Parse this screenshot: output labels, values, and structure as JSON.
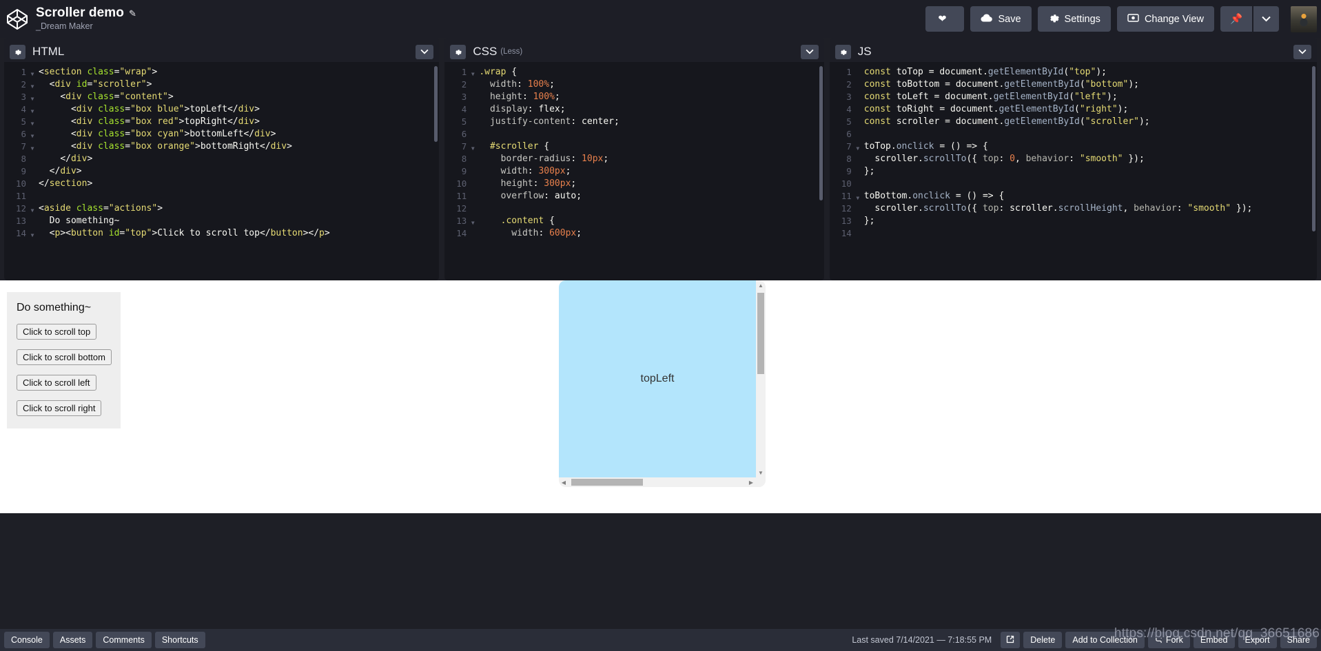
{
  "header": {
    "logo_icon": "codepen-logo-icon",
    "pen_title": "Scroller demo",
    "edit_icon": "pencil-icon",
    "author": "_Dream Maker",
    "buttons": {
      "love_label": "",
      "love_icon": "heart-icon",
      "save_label": "Save",
      "save_icon": "cloud-icon",
      "settings_label": "Settings",
      "settings_icon": "gear-icon",
      "change_view_label": "Change View",
      "change_view_icon": "eye-icon",
      "pin_icon": "pin-icon",
      "caret_icon": "chevron-down-icon",
      "avatar_icon": "user-avatar"
    }
  },
  "editors": {
    "html": {
      "title": "HTML",
      "sub": "",
      "gear_icon": "gear-icon",
      "caret_icon": "chevron-down-icon",
      "lines": [
        {
          "n": "1",
          "fold": true,
          "html": "<span class=\"t-punc\">&lt;</span><span class=\"t-tag\">section</span> <span class=\"t-attr\">class</span><span class=\"t-punc\">=</span><span class=\"t-str\">\"wrap\"</span><span class=\"t-punc\">&gt;</span>"
        },
        {
          "n": "2",
          "fold": true,
          "html": "  <span class=\"t-punc\">&lt;</span><span class=\"t-tag\">div</span> <span class=\"t-attr\">id</span><span class=\"t-punc\">=</span><span class=\"t-str\">\"scroller\"</span><span class=\"t-punc\">&gt;</span>"
        },
        {
          "n": "3",
          "fold": true,
          "html": "    <span class=\"t-punc\">&lt;</span><span class=\"t-tag\">div</span> <span class=\"t-attr\">class</span><span class=\"t-punc\">=</span><span class=\"t-str\">\"content\"</span><span class=\"t-punc\">&gt;</span>"
        },
        {
          "n": "4",
          "fold": true,
          "html": "      <span class=\"t-punc\">&lt;</span><span class=\"t-tag\">div</span> <span class=\"t-attr\">class</span><span class=\"t-punc\">=</span><span class=\"t-str\">\"box blue\"</span><span class=\"t-punc\">&gt;</span><span class=\"t-txt\">topLeft</span><span class=\"t-punc\">&lt;/</span><span class=\"t-tag\">div</span><span class=\"t-punc\">&gt;</span>"
        },
        {
          "n": "5",
          "fold": true,
          "html": "      <span class=\"t-punc\">&lt;</span><span class=\"t-tag\">div</span> <span class=\"t-attr\">class</span><span class=\"t-punc\">=</span><span class=\"t-str\">\"box red\"</span><span class=\"t-punc\">&gt;</span><span class=\"t-txt\">topRight</span><span class=\"t-punc\">&lt;/</span><span class=\"t-tag\">div</span><span class=\"t-punc\">&gt;</span>"
        },
        {
          "n": "6",
          "fold": true,
          "html": "      <span class=\"t-punc\">&lt;</span><span class=\"t-tag\">div</span> <span class=\"t-attr\">class</span><span class=\"t-punc\">=</span><span class=\"t-str\">\"box cyan\"</span><span class=\"t-punc\">&gt;</span><span class=\"t-txt\">bottomLeft</span><span class=\"t-punc\">&lt;/</span><span class=\"t-tag\">div</span><span class=\"t-punc\">&gt;</span>"
        },
        {
          "n": "7",
          "fold": true,
          "html": "      <span class=\"t-punc\">&lt;</span><span class=\"t-tag\">div</span> <span class=\"t-attr\">class</span><span class=\"t-punc\">=</span><span class=\"t-str\">\"box orange\"</span><span class=\"t-punc\">&gt;</span><span class=\"t-txt\">bottomRight</span><span class=\"t-punc\">&lt;/</span><span class=\"t-tag\">div</span><span class=\"t-punc\">&gt;</span>"
        },
        {
          "n": "8",
          "fold": false,
          "html": "    <span class=\"t-punc\">&lt;/</span><span class=\"t-tag\">div</span><span class=\"t-punc\">&gt;</span>"
        },
        {
          "n": "9",
          "fold": false,
          "html": "  <span class=\"t-punc\">&lt;/</span><span class=\"t-tag\">div</span><span class=\"t-punc\">&gt;</span>"
        },
        {
          "n": "10",
          "fold": false,
          "html": "<span class=\"t-punc\">&lt;/</span><span class=\"t-tag\">section</span><span class=\"t-punc\">&gt;</span>"
        },
        {
          "n": "11",
          "fold": false,
          "html": ""
        },
        {
          "n": "12",
          "fold": true,
          "html": "<span class=\"t-punc\">&lt;</span><span class=\"t-tag\">aside</span> <span class=\"t-attr\">class</span><span class=\"t-punc\">=</span><span class=\"t-str\">\"actions\"</span><span class=\"t-punc\">&gt;</span>"
        },
        {
          "n": "13",
          "fold": false,
          "html": "  <span class=\"t-txt\">Do something~</span>"
        },
        {
          "n": "14",
          "fold": true,
          "html": "  <span class=\"t-punc\">&lt;</span><span class=\"t-tag\">p</span><span class=\"t-punc\">&gt;&lt;</span><span class=\"t-tag\">button</span> <span class=\"t-attr\">id</span><span class=\"t-punc\">=</span><span class=\"t-str\">\"top\"</span><span class=\"t-punc\">&gt;</span><span class=\"t-txt\">Click to scroll top</span><span class=\"t-punc\">&lt;/</span><span class=\"t-tag\">button</span><span class=\"t-punc\">&gt;&lt;/</span><span class=\"t-tag\">p</span><span class=\"t-punc\">&gt;</span>"
        }
      ],
      "plain_lines": [
        "<section class=\"wrap\">",
        "  <div id=\"scroller\">",
        "    <div class=\"content\">",
        "      <div class=\"box blue\">topLeft</div>",
        "      <div class=\"box red\">topRight</div>",
        "      <div class=\"box cyan\">bottomLeft</div>",
        "      <div class=\"box orange\">bottomRight</div>",
        "    </div>",
        "  </div>",
        "</section>",
        "",
        "<aside class=\"actions\">",
        "  Do something~",
        "  <p><button id=\"top\">Click to scroll top</button></p>"
      ]
    },
    "css": {
      "title": "CSS",
      "sub": "(Less)",
      "gear_icon": "gear-icon",
      "caret_icon": "chevron-down-icon",
      "lines": [
        {
          "n": "1",
          "fold": true,
          "html": "<span class=\"t-sel\">.wrap</span> <span class=\"t-punc\">{</span>"
        },
        {
          "n": "2",
          "fold": false,
          "html": "  <span class=\"t-prop\">width</span><span class=\"t-punc\">:</span> <span class=\"t-num\">100%</span><span class=\"t-punc\">;</span>"
        },
        {
          "n": "3",
          "fold": false,
          "html": "  <span class=\"t-prop\">height</span><span class=\"t-punc\">:</span> <span class=\"t-num\">100%</span><span class=\"t-punc\">;</span>"
        },
        {
          "n": "4",
          "fold": false,
          "html": "  <span class=\"t-prop\">display</span><span class=\"t-punc\">:</span> <span class=\"t-val\">flex</span><span class=\"t-punc\">;</span>"
        },
        {
          "n": "5",
          "fold": false,
          "html": "  <span class=\"t-prop\">justify-content</span><span class=\"t-punc\">:</span> <span class=\"t-val\">center</span><span class=\"t-punc\">;</span>"
        },
        {
          "n": "6",
          "fold": false,
          "html": ""
        },
        {
          "n": "7",
          "fold": true,
          "html": "  <span class=\"t-sel\">#scroller</span> <span class=\"t-punc\">{</span>"
        },
        {
          "n": "8",
          "fold": false,
          "html": "    <span class=\"t-prop\">border-radius</span><span class=\"t-punc\">:</span> <span class=\"t-num\">10px</span><span class=\"t-punc\">;</span>"
        },
        {
          "n": "9",
          "fold": false,
          "html": "    <span class=\"t-prop\">width</span><span class=\"t-punc\">:</span> <span class=\"t-num\">300px</span><span class=\"t-punc\">;</span>"
        },
        {
          "n": "10",
          "fold": false,
          "html": "    <span class=\"t-prop\">height</span><span class=\"t-punc\">:</span> <span class=\"t-num\">300px</span><span class=\"t-punc\">;</span>"
        },
        {
          "n": "11",
          "fold": false,
          "html": "    <span class=\"t-prop\">overflow</span><span class=\"t-punc\">:</span> <span class=\"t-val\">auto</span><span class=\"t-punc\">;</span>"
        },
        {
          "n": "12",
          "fold": false,
          "html": ""
        },
        {
          "n": "13",
          "fold": true,
          "html": "    <span class=\"t-sel\">.content</span> <span class=\"t-punc\">{</span>"
        },
        {
          "n": "14",
          "fold": false,
          "html": "      <span class=\"t-prop\">width</span><span class=\"t-punc\">:</span> <span class=\"t-num\">600px</span><span class=\"t-punc\">;</span>"
        }
      ],
      "plain_lines": [
        ".wrap {",
        "  width: 100%;",
        "  height: 100%;",
        "  display: flex;",
        "  justify-content: center;",
        "",
        "  #scroller {",
        "    border-radius: 10px;",
        "    width: 300px;",
        "    height: 300px;",
        "    overflow: auto;",
        "",
        "    .content {",
        "      width: 600px;"
      ]
    },
    "js": {
      "title": "JS",
      "sub": "",
      "gear_icon": "gear-icon",
      "caret_icon": "chevron-down-icon",
      "lines": [
        {
          "n": "1",
          "fold": false,
          "html": "<span class=\"t-kw\">const</span> <span class=\"t-var\">toTop</span> <span class=\"t-op\">=</span> <span class=\"t-var\">document</span><span class=\"t-punc\">.</span><span class=\"t-fn\">getElementById</span><span class=\"t-punc\">(</span><span class=\"t-str\">\"top\"</span><span class=\"t-punc\">);</span>"
        },
        {
          "n": "2",
          "fold": false,
          "html": "<span class=\"t-kw\">const</span> <span class=\"t-var\">toBottom</span> <span class=\"t-op\">=</span> <span class=\"t-var\">document</span><span class=\"t-punc\">.</span><span class=\"t-fn\">getElementById</span><span class=\"t-punc\">(</span><span class=\"t-str\">\"bottom\"</span><span class=\"t-punc\">);</span>"
        },
        {
          "n": "3",
          "fold": false,
          "html": "<span class=\"t-kw\">const</span> <span class=\"t-var\">toLeft</span> <span class=\"t-op\">=</span> <span class=\"t-var\">document</span><span class=\"t-punc\">.</span><span class=\"t-fn\">getElementById</span><span class=\"t-punc\">(</span><span class=\"t-str\">\"left\"</span><span class=\"t-punc\">);</span>"
        },
        {
          "n": "4",
          "fold": false,
          "html": "<span class=\"t-kw\">const</span> <span class=\"t-var\">toRight</span> <span class=\"t-op\">=</span> <span class=\"t-var\">document</span><span class=\"t-punc\">.</span><span class=\"t-fn\">getElementById</span><span class=\"t-punc\">(</span><span class=\"t-str\">\"right\"</span><span class=\"t-punc\">);</span>"
        },
        {
          "n": "5",
          "fold": false,
          "html": "<span class=\"t-kw\">const</span> <span class=\"t-var\">scroller</span> <span class=\"t-op\">=</span> <span class=\"t-var\">document</span><span class=\"t-punc\">.</span><span class=\"t-fn\">getElementById</span><span class=\"t-punc\">(</span><span class=\"t-str\">\"scroller\"</span><span class=\"t-punc\">);</span>"
        },
        {
          "n": "6",
          "fold": false,
          "html": ""
        },
        {
          "n": "7",
          "fold": true,
          "html": "<span class=\"t-var\">toTop</span><span class=\"t-punc\">.</span><span class=\"t-fn\">onclick</span> <span class=\"t-op\">=</span> <span class=\"t-punc\">() =&gt; {</span>"
        },
        {
          "n": "8",
          "fold": false,
          "html": "  <span class=\"t-var\">scroller</span><span class=\"t-punc\">.</span><span class=\"t-fn\">scrollTo</span><span class=\"t-punc\">({</span> <span class=\"t-dim\">top</span><span class=\"t-punc\">:</span> <span class=\"t-num\">0</span><span class=\"t-punc\">,</span> <span class=\"t-dim\">behavior</span><span class=\"t-punc\">:</span> <span class=\"t-str\">\"smooth\"</span> <span class=\"t-punc\">});</span>"
        },
        {
          "n": "9",
          "fold": false,
          "html": "<span class=\"t-punc\">};</span>"
        },
        {
          "n": "10",
          "fold": false,
          "html": ""
        },
        {
          "n": "11",
          "fold": true,
          "html": "<span class=\"t-var\">toBottom</span><span class=\"t-punc\">.</span><span class=\"t-fn\">onclick</span> <span class=\"t-op\">=</span> <span class=\"t-punc\">() =&gt; {</span>"
        },
        {
          "n": "12",
          "fold": false,
          "html": "  <span class=\"t-var\">scroller</span><span class=\"t-punc\">.</span><span class=\"t-fn\">scrollTo</span><span class=\"t-punc\">({</span> <span class=\"t-dim\">top</span><span class=\"t-punc\">:</span> <span class=\"t-var\">scroller</span><span class=\"t-punc\">.</span><span class=\"t-fn\">scrollHeight</span><span class=\"t-punc\">,</span> <span class=\"t-dim\">behavior</span><span class=\"t-punc\">:</span> <span class=\"t-str\">\"smooth\"</span> <span class=\"t-punc\">});</span>"
        },
        {
          "n": "13",
          "fold": false,
          "html": "<span class=\"t-punc\">};</span>"
        },
        {
          "n": "14",
          "fold": false,
          "html": ""
        }
      ],
      "plain_lines": [
        "const toTop = document.getElementById(\"top\");",
        "const toBottom = document.getElementById(\"bottom\");",
        "const toLeft = document.getElementById(\"left\");",
        "const toRight = document.getElementById(\"right\");",
        "const scroller = document.getElementById(\"scroller\");",
        "",
        "toTop.onclick = () => {",
        "  scroller.scrollTo({ top: 0, behavior: \"smooth\" });",
        "};",
        "",
        "toBottom.onclick = () => {",
        "  scroller.scrollTo({ top: scroller.scrollHeight, behavior: \"smooth\" });",
        "};",
        ""
      ]
    }
  },
  "preview": {
    "actions_title": "Do something~",
    "buttons": [
      "Click to scroll top",
      "Click to scroll bottom",
      "Click to scroll left",
      "Click to scroll right"
    ],
    "scroller_box_label": "topLeft",
    "scroller_box_color": "#b3e5fc"
  },
  "footer": {
    "left_buttons": [
      "Console",
      "Assets",
      "Comments",
      "Shortcuts"
    ],
    "last_saved": "Last saved 7/14/2021 — 7:18:55 PM",
    "open_icon": "external-link-icon",
    "right_buttons": [
      "Delete",
      "Add to Collection",
      "Fork",
      "Embed",
      "Export",
      "Share"
    ],
    "fork_icon": "fork-icon"
  },
  "watermark": "https://blog.csdn.net/qq_36651686",
  "colors": {
    "chrome_bg": "#1d1e26",
    "button_bg": "#434857",
    "code_bg": "#16171d",
    "footer_bg": "#2a2d38",
    "preview_bg": "#ffffff",
    "accent_blue": "#b3e5fc"
  }
}
